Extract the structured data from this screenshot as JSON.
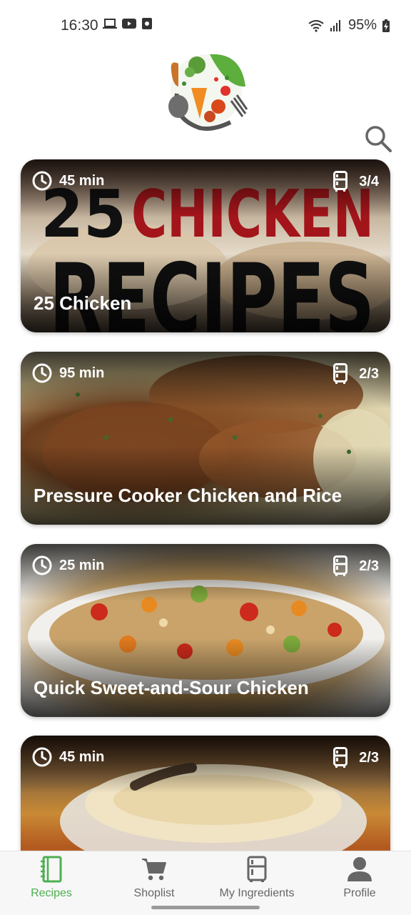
{
  "status_bar": {
    "time": "16:30",
    "battery": "95%"
  },
  "header": {
    "logo": "veggie-logo",
    "search_icon": "search-icon"
  },
  "recipes": [
    {
      "time": "45 min",
      "ratio": "3/4",
      "title": "25 Chicken",
      "banner_line1": "25 CHICKEN",
      "banner_line2": "RECIPES"
    },
    {
      "time": "95 min",
      "ratio": "2/3",
      "title": "Pressure Cooker Chicken and Rice"
    },
    {
      "time": "25 min",
      "ratio": "2/3",
      "title": "Quick Sweet-and-Sour Chicken"
    },
    {
      "time": "45 min",
      "ratio": "2/3",
      "title": ""
    }
  ],
  "bottom_nav": {
    "items": [
      {
        "label": "Recipes",
        "icon": "notebook-icon",
        "active": true
      },
      {
        "label": "Shoplist",
        "icon": "cart-icon",
        "active": false
      },
      {
        "label": "My Ingredients",
        "icon": "fridge-icon",
        "active": false
      },
      {
        "label": "Profile",
        "icon": "person-icon",
        "active": false
      }
    ]
  },
  "colors": {
    "accent": "#4caf50",
    "nav_inactive": "#666666"
  }
}
